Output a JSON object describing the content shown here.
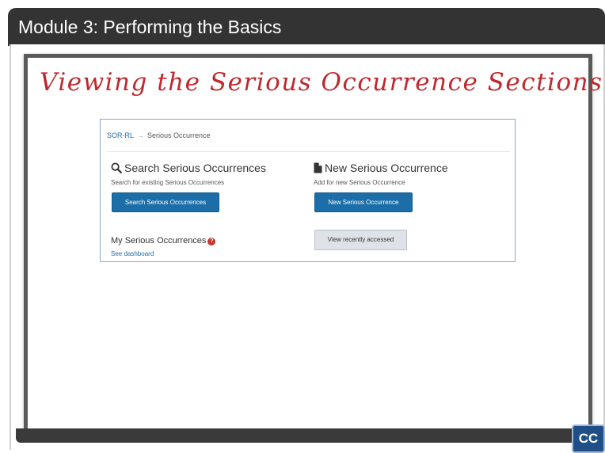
{
  "title_bar": {
    "title": "Module 3:  Performing the Basics"
  },
  "slide": {
    "heading": "Viewing the Serious Occurrence Sections",
    "cc_label": "CC"
  },
  "app": {
    "breadcrumb": {
      "root": "SOR-RL",
      "separator": "→",
      "current": "Serious Occurrence"
    },
    "search_section": {
      "icon": "search-icon",
      "title": "Search Serious Occurrences",
      "subtitle": "Search for existing Serious Occurrences",
      "button_label": "Search Serious Occurrences"
    },
    "new_section": {
      "icon": "document-icon",
      "title": "New Serious Occurrence",
      "subtitle": "Add for new Serious Occurrence",
      "button_label": "New Serious Occurrence"
    },
    "my_section": {
      "title": "My Serious Occurrences",
      "badge_icon": "help-icon",
      "badge_glyph": "?",
      "link_label": "See dashboard"
    },
    "recent_button_label": "View recently accessed"
  },
  "colors": {
    "title_bar": "#333333",
    "heading": "#c0282d",
    "primary_button": "#1b6ea8",
    "link": "#1f6aa5",
    "cc_button": "#1f4f86"
  }
}
